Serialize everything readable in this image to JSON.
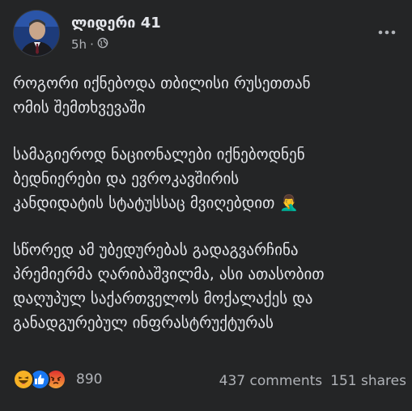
{
  "post": {
    "author": "ლიდერი 41",
    "time": "5h",
    "separator": "·",
    "paragraphs": [
      [
        "როგორი იქნებოდა თბილისი რუსეთთან",
        "ომის შემთხვევაში"
      ],
      [
        "სამაგიეროდ ნაციონალები იქნებოდნენ",
        "ბედნიერები და ევროკავშირის",
        "კანდიდატის სტატუსსაც მვიღებდით"
      ],
      [
        "სწორედ ამ უბედურებას გადაგვარჩინა",
        "პრემიერმა ღარიბაშვილმა, ასი ათასობით",
        "დაღუპულ საქართველოს მოქალაქეს და",
        "განადგურებულ ინფრასტრუქტურას"
      ]
    ],
    "emoji": "🤦‍♂️"
  },
  "footer": {
    "reaction_count": "890",
    "comments": "437 comments",
    "shares": "151 shares"
  },
  "colors": {
    "background": "#242526",
    "text": "#e4e6eb",
    "secondary": "#b0b3b8",
    "like": "#1877f2",
    "haha": "#f7b125",
    "angry": "#e9710f"
  },
  "icons": [
    "globe-icon",
    "more-options-icon",
    "haha-reaction-icon",
    "like-reaction-icon",
    "angry-reaction-icon"
  ]
}
